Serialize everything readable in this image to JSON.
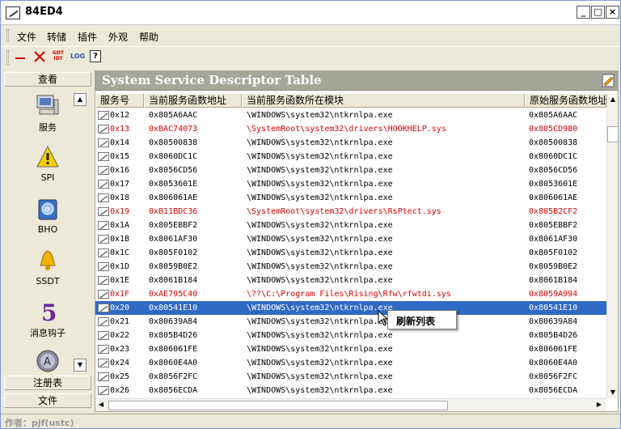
{
  "window": {
    "title": "84ED4",
    "minimize_label": "_",
    "maximize_label": "□",
    "close_label": "×"
  },
  "menu": [
    "文件",
    "转储",
    "插件",
    "外观",
    "帮助"
  ],
  "toolbar": {
    "buttons": [
      "minus-icon",
      "cross-icon",
      "gdt-idt-icon",
      "log-icon",
      "help-icon"
    ],
    "gdt_label": "GDT",
    "idt_label": "IDT",
    "log_label": "LOG",
    "help_label": "?"
  },
  "sidebar": {
    "top_header": "查看",
    "items": [
      {
        "label": "服务",
        "icon": "computer-icon"
      },
      {
        "label": "SPI",
        "icon": "warning-icon"
      },
      {
        "label": "BHO",
        "icon": "ie-icon"
      },
      {
        "label": "SSDT",
        "icon": "bell-icon"
      },
      {
        "label": "消息钩子",
        "icon": "hook-5-icon"
      },
      {
        "label": "",
        "icon": "circle-a-icon"
      }
    ],
    "bottom_headers": [
      "注册表",
      "文件"
    ]
  },
  "panel": {
    "title": "System Service Descriptor Table",
    "columns": [
      "服务号",
      "当前服务函数地址",
      "当前服务函数所在模块",
      "原始服务函数地址"
    ]
  },
  "rows": [
    {
      "num": "0x12",
      "addr": "0x805A6AAC",
      "module": "\\WINDOWS\\system32\\ntkrnlpa.exe",
      "orig": "0x805A6AAC",
      "state": "normal"
    },
    {
      "num": "0x13",
      "addr": "0xBAC74073",
      "module": "\\SystemRoot\\system32\\drivers\\HOOKHELP.sys",
      "orig": "0x805CD980",
      "state": "red"
    },
    {
      "num": "0x14",
      "addr": "0x80500838",
      "module": "\\WINDOWS\\system32\\ntkrnlpa.exe",
      "orig": "0x80500838",
      "state": "normal"
    },
    {
      "num": "0x15",
      "addr": "0x8060DC1C",
      "module": "\\WINDOWS\\system32\\ntkrnlpa.exe",
      "orig": "0x8060DC1C",
      "state": "normal"
    },
    {
      "num": "0x16",
      "addr": "0x8056CD56",
      "module": "\\WINDOWS\\system32\\ntkrnlpa.exe",
      "orig": "0x8056CD56",
      "state": "normal"
    },
    {
      "num": "0x17",
      "addr": "0x8053601E",
      "module": "\\WINDOWS\\system32\\ntkrnlpa.exe",
      "orig": "0x8053601E",
      "state": "normal"
    },
    {
      "num": "0x18",
      "addr": "0x806061AE",
      "module": "\\WINDOWS\\system32\\ntkrnlpa.exe",
      "orig": "0x806061AE",
      "state": "normal"
    },
    {
      "num": "0x19",
      "addr": "0xB11BDC36",
      "module": "\\SystemRoot\\system32\\drivers\\RsPtect.sys",
      "orig": "0x805B2CF2",
      "state": "red"
    },
    {
      "num": "0x1A",
      "addr": "0x805EBBF2",
      "module": "\\WINDOWS\\system32\\ntkrnlpa.exe",
      "orig": "0x805EBBF2",
      "state": "normal"
    },
    {
      "num": "0x1B",
      "addr": "0x8061AF30",
      "module": "\\WINDOWS\\system32\\ntkrnlpa.exe",
      "orig": "0x8061AF30",
      "state": "normal"
    },
    {
      "num": "0x1C",
      "addr": "0x805F0102",
      "module": "\\WINDOWS\\system32\\ntkrnlpa.exe",
      "orig": "0x805F0102",
      "state": "normal"
    },
    {
      "num": "0x1D",
      "addr": "0x8059B0E2",
      "module": "\\WINDOWS\\system32\\ntkrnlpa.exe",
      "orig": "0x8059B0E2",
      "state": "normal"
    },
    {
      "num": "0x1E",
      "addr": "0x8061B184",
      "module": "\\WINDOWS\\system32\\ntkrnlpa.exe",
      "orig": "0x8061B184",
      "state": "normal"
    },
    {
      "num": "0x1F",
      "addr": "0xAE795C40",
      "module": "\\??\\C:\\Program Files\\Rising\\Rfw\\rfwtdi.sys",
      "orig": "0x8059A994",
      "state": "red"
    },
    {
      "num": "0x20",
      "addr": "0x80541E10",
      "module": "\\WINDOWS\\system32\\ntkrnlpa.exe",
      "orig": "0x80541E10",
      "state": "selected"
    },
    {
      "num": "0x21",
      "addr": "0x80639A84",
      "module": "\\WINDOWS\\system32\\ntkrnlpa.exe",
      "orig": "0x80639A84",
      "state": "normal"
    },
    {
      "num": "0x22",
      "addr": "0x805B4D26",
      "module": "\\WINDOWS\\system32\\ntkrnlpa.exe",
      "orig": "0x805B4D26",
      "state": "normal"
    },
    {
      "num": "0x23",
      "addr": "0x806061FE",
      "module": "\\WINDOWS\\system32\\ntkrnlpa.exe",
      "orig": "0x806061FE",
      "state": "normal"
    },
    {
      "num": "0x24",
      "addr": "0x8060E4A0",
      "module": "\\WINDOWS\\system32\\ntkrnlpa.exe",
      "orig": "0x8060E4A0",
      "state": "normal"
    },
    {
      "num": "0x25",
      "addr": "0x8056F2FC",
      "module": "\\WINDOWS\\system32\\ntkrnlpa.exe",
      "orig": "0x8056F2FC",
      "state": "normal"
    },
    {
      "num": "0x26",
      "addr": "0x8056ECDA",
      "module": "\\WINDOWS\\system32\\ntkrnlpa.exe",
      "orig": "0x8056ECDA",
      "state": "normal"
    }
  ],
  "context_menu": {
    "item": "刷新列表"
  },
  "status": {
    "text": "作者：pjf(ustc)"
  },
  "colors": {
    "hooked": "#e00000",
    "selected_bg": "#316ac5",
    "banner_bg": "#a7a69a"
  }
}
